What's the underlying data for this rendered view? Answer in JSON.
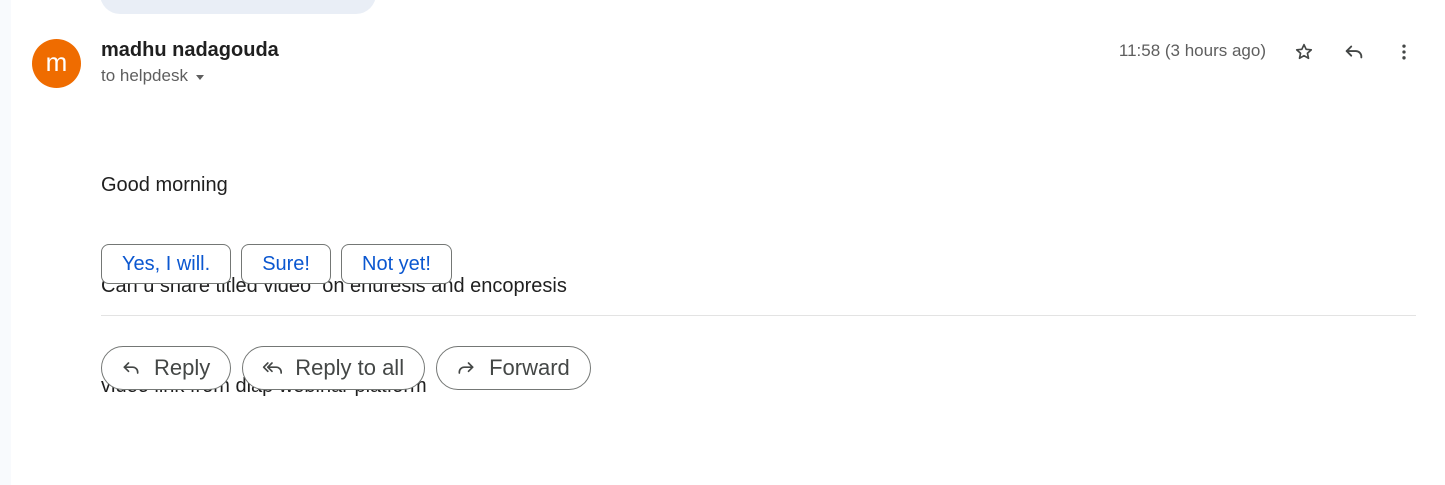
{
  "message": {
    "sender": {
      "name": "madhu nadagouda",
      "avatar_initial": "m",
      "avatar_color": "#ef6c00"
    },
    "recipient_line": "to helpdesk",
    "timestamp": "11:58 (3 hours ago)",
    "header_icons": [
      "star-icon",
      "reply-icon",
      "more-vertical-icon"
    ],
    "body_lines": [
      "Good morning",
      "Can u share titled video  on enuresis and encopresis",
      "video link from diap webinar platform"
    ]
  },
  "smart_replies": [
    "Yes, I will.",
    "Sure!",
    "Not yet!"
  ],
  "actions": {
    "reply": {
      "label": "Reply",
      "icon": "reply-icon"
    },
    "reply_all": {
      "label": "Reply to all",
      "icon": "reply-all-icon"
    },
    "forward": {
      "label": "Forward",
      "icon": "forward-icon"
    }
  },
  "colors": {
    "accent_blue": "#0b57d0",
    "text_primary": "#1f1f1f",
    "text_secondary": "#5e5e5e"
  }
}
